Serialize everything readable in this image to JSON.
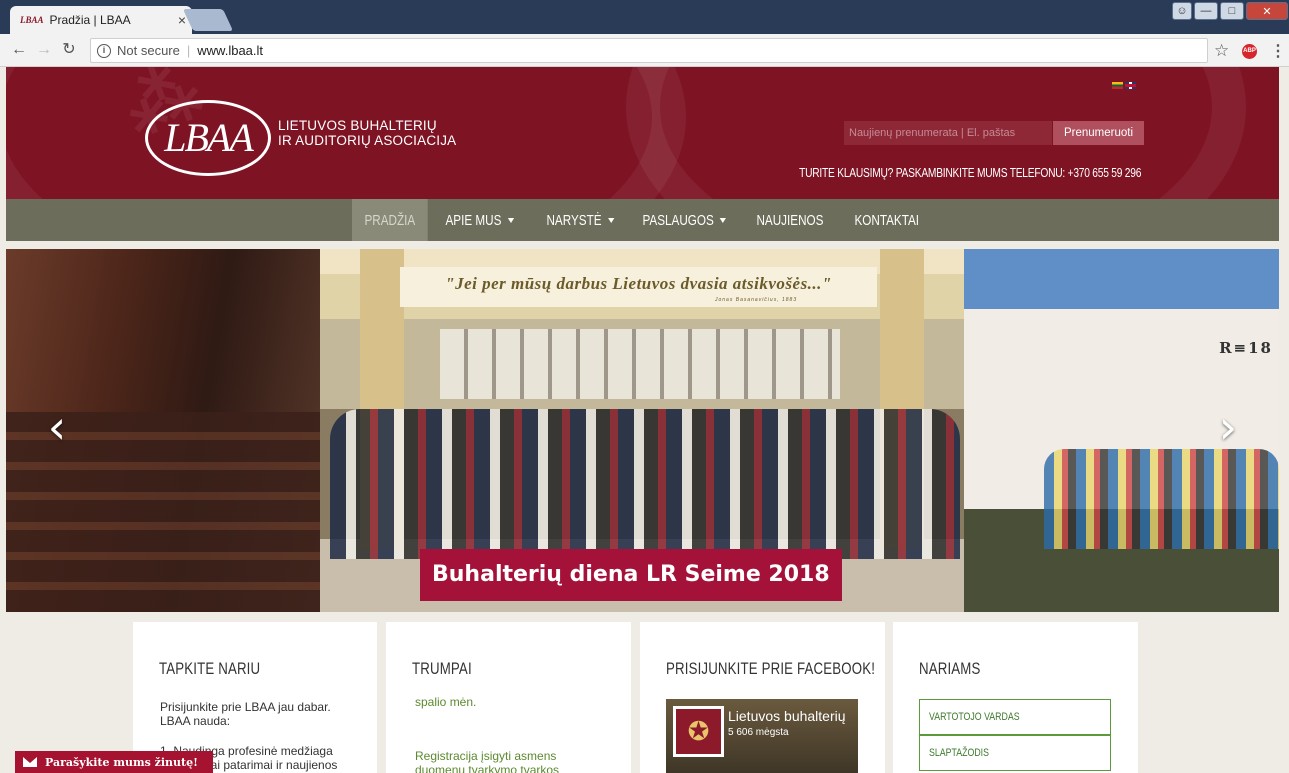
{
  "browser": {
    "tab_title": "Pradžia | LBAA",
    "tab_favicon": "LBAA",
    "security_label": "Not secure",
    "url": "www.lbaa.lt",
    "icons": [
      "back-arrow-icon",
      "forward-arrow-icon",
      "reload-icon",
      "info-icon",
      "star-icon",
      "adblock-icon",
      "menu-icon"
    ]
  },
  "header": {
    "logo_mark": "LBAA",
    "logo_line1": "LIETUVOS BUHALTERIŲ",
    "logo_line2": "IR AUDITORIŲ ASOCIACIJA",
    "newsletter_placeholder": "Naujienų prenumerata | El. paštas",
    "subscribe_label": "Prenumeruoti",
    "phone_text": "TURITE KLAUSIMŲ? PASKAMBINKITE MUMS TELEFONU: +370 655 59 296"
  },
  "nav": {
    "items": [
      {
        "label": "PRADŽIA",
        "dropdown": false,
        "active": true
      },
      {
        "label": "APIE MUS",
        "dropdown": true,
        "active": false
      },
      {
        "label": "NARYSTĖ",
        "dropdown": true,
        "active": false
      },
      {
        "label": "PASLAUGOS",
        "dropdown": true,
        "active": false
      },
      {
        "label": "NAUJIENOS",
        "dropdown": false,
        "active": false
      },
      {
        "label": "KONTAKTAI",
        "dropdown": false,
        "active": false
      }
    ]
  },
  "slider": {
    "banner_quote": "\"Jei per mūsų darbus Lietuvos dvasia atsikvošės...\"",
    "banner_author": "Jonas Basanavičius, 1883",
    "building_sign": "R≡18",
    "caption": "Buhalterių diena LR Seime 2018"
  },
  "boxes": {
    "join": {
      "title": "TAPKITE NARIU",
      "p1": "Prisijunkite prie LBAA jau dabar. LBAA nauda:",
      "p2": "1. Naudinga profesinė medžiaga",
      "p3": "iai patarimai ir naujienos"
    },
    "brief": {
      "title": "TRUMPAI",
      "line1": "spalio mėn.",
      "line2": "Registracija įsigyti asmens duomenų tvarkymo tvarkos"
    },
    "facebook": {
      "title": "PRISIJUNKITE PRIE FACEBOOK!",
      "page_name": "Lietuvos buhalterių",
      "likes": "5 606 mėgsta"
    },
    "members": {
      "title": "NARIAMS",
      "username_label": "VARTOTOJO VARDAS",
      "password_label": "SLAPTAŽODIS"
    }
  },
  "chat": {
    "label": "Parašykite mums žinutę!"
  },
  "colors": {
    "brand": "#7e1324",
    "nav": "#6c6d5b",
    "caption": "#a4123a",
    "accent_green": "#5c8a2f"
  }
}
